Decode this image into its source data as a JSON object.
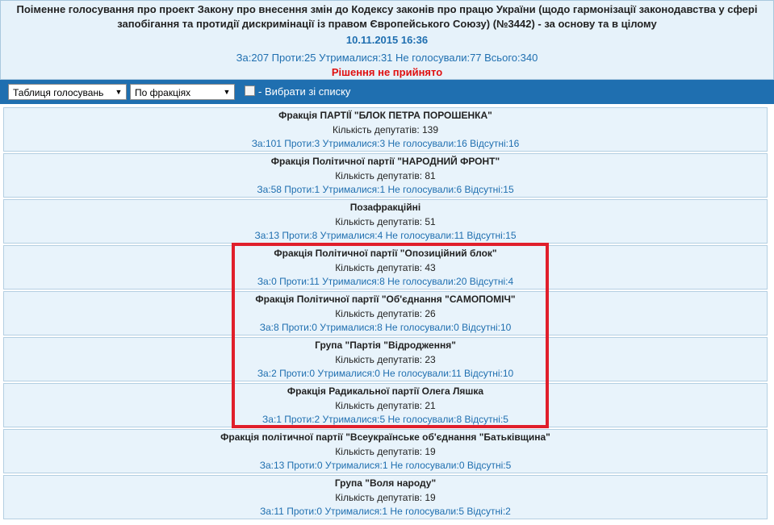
{
  "header": {
    "title": "Поіменне голосування про проект Закону про внесення змін до Кодексу законів про працю України (щодо гармонізації законодавства у сфері запобігання та протидії дискримінації із правом Європейського Союзу) (№3442) - за основу та в цілому",
    "datetime": "10.11.2015 16:36",
    "counts": "За:207 Проти:25 Утрималися:31 Не голосували:77 Всього:340",
    "decision": "Рішення не прийнято"
  },
  "toolbar": {
    "view_select": "Таблиця голосувань",
    "group_select": "По фракціях",
    "choose_label": "- Вибрати зі списку"
  },
  "factions": [
    {
      "name": "Фракція ПАРТІЇ \"БЛОК ПЕТРА ПОРОШЕНКА\"",
      "count": "Кількість депутатів: 139",
      "votes": "За:101 Проти:3 Утрималися:3 Не голосували:16 Відсутні:16"
    },
    {
      "name": "Фракція Політичної партії \"НАРОДНИЙ ФРОНТ\"",
      "count": "Кількість депутатів: 81",
      "votes": "За:58 Проти:1 Утрималися:1 Не голосували:6 Відсутні:15"
    },
    {
      "name": "Позафракційні",
      "count": "Кількість депутатів: 51",
      "votes": "За:13 Проти:8 Утрималися:4 Не голосували:11 Відсутні:15"
    },
    {
      "name": "Фракція Політичної партії \"Опозиційний блок\"",
      "count": "Кількість депутатів: 43",
      "votes": "За:0 Проти:11 Утрималися:8 Не голосували:20 Відсутні:4"
    },
    {
      "name": "Фракція Політичної партії \"Об'єднання \"САМОПОМІЧ\"",
      "count": "Кількість депутатів: 26",
      "votes": "За:8 Проти:0 Утрималися:8 Не голосували:0 Відсутні:10"
    },
    {
      "name": "Група \"Партія \"Відродження\"",
      "count": "Кількість депутатів: 23",
      "votes": "За:2 Проти:0 Утрималися:0 Не голосували:11 Відсутні:10"
    },
    {
      "name": "Фракція Радикальної партії Олега Ляшка",
      "count": "Кількість депутатів: 21",
      "votes": "За:1 Проти:2 Утрималися:5 Не голосували:8 Відсутні:5"
    },
    {
      "name": "Фракція політичної партії \"Всеукраїнське об'єднання \"Батьківщина\"",
      "count": "Кількість депутатів: 19",
      "votes": "За:13 Проти:0 Утрималися:1 Не голосували:0 Відсутні:5"
    },
    {
      "name": "Група \"Воля народу\"",
      "count": "Кількість депутатів: 19",
      "votes": "За:11 Проти:0 Утрималися:1 Не голосували:5 Відсутні:2"
    }
  ],
  "colors": {
    "accent": "#1f6fb0",
    "highlight": "#e01f2b",
    "decision": "#e01010"
  }
}
